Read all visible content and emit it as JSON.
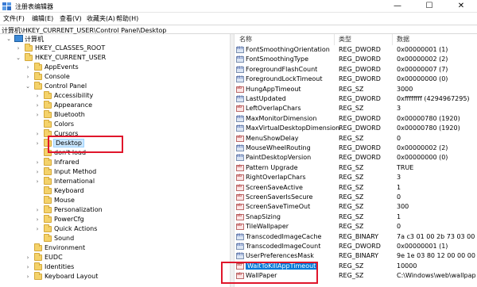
{
  "window": {
    "title": "注册表编辑器",
    "minimize": "—",
    "maximize": "☐",
    "close": "✕"
  },
  "menu": [
    "文件(F)",
    "编辑(E)",
    "查看(V)",
    "收藏夹(A)",
    "帮助(H)"
  ],
  "address": "计算机\\HKEY_CURRENT_USER\\Control Panel\\Desktop",
  "tree": [
    {
      "label": "计算机",
      "expander": "⌄",
      "kind": "pc"
    },
    {
      "label": "HKEY_CLASSES_ROOT",
      "expander": "›",
      "kind": "folder"
    },
    {
      "label": "HKEY_CURRENT_USER",
      "expander": "⌄",
      "kind": "folder"
    },
    {
      "label": "AppEvents",
      "expander": "›",
      "kind": "folder"
    },
    {
      "label": "Console",
      "expander": "›",
      "kind": "folder"
    },
    {
      "label": "Control Panel",
      "expander": "⌄",
      "kind": "folder"
    },
    {
      "label": "Accessibility",
      "expander": "›",
      "kind": "folder"
    },
    {
      "label": "Appearance",
      "expander": "›",
      "kind": "folder"
    },
    {
      "label": "Bluetooth",
      "expander": "›",
      "kind": "folder"
    },
    {
      "label": "Colors",
      "expander": "",
      "kind": "folder"
    },
    {
      "label": "Cursors",
      "expander": "›",
      "kind": "folder"
    },
    {
      "label": "Desktop",
      "expander": "›",
      "kind": "folder",
      "selected": true
    },
    {
      "label": "don't load",
      "expander": "",
      "kind": "folder"
    },
    {
      "label": "Infrared",
      "expander": "›",
      "kind": "folder"
    },
    {
      "label": "Input Method",
      "expander": "›",
      "kind": "folder"
    },
    {
      "label": "International",
      "expander": "›",
      "kind": "folder"
    },
    {
      "label": "Keyboard",
      "expander": "",
      "kind": "folder"
    },
    {
      "label": "Mouse",
      "expander": "",
      "kind": "folder"
    },
    {
      "label": "Personalization",
      "expander": "›",
      "kind": "folder"
    },
    {
      "label": "PowerCfg",
      "expander": "›",
      "kind": "folder"
    },
    {
      "label": "Quick Actions",
      "expander": "›",
      "kind": "folder"
    },
    {
      "label": "Sound",
      "expander": "",
      "kind": "folder"
    },
    {
      "label": "Environment",
      "expander": "",
      "kind": "folder"
    },
    {
      "label": "EUDC",
      "expander": "›",
      "kind": "folder"
    },
    {
      "label": "Identities",
      "expander": "›",
      "kind": "folder"
    },
    {
      "label": "Keyboard Layout",
      "expander": "›",
      "kind": "folder"
    }
  ],
  "columns": {
    "name": "名称",
    "type": "类型",
    "data": "数据"
  },
  "values": [
    {
      "name": "FontSmoothingOrientation",
      "type": "REG_DWORD",
      "data": "0x00000001 (1)",
      "icon": "dword"
    },
    {
      "name": "FontSmoothingType",
      "type": "REG_DWORD",
      "data": "0x00000002 (2)",
      "icon": "dword"
    },
    {
      "name": "ForegroundFlashCount",
      "type": "REG_DWORD",
      "data": "0x00000007 (7)",
      "icon": "dword"
    },
    {
      "name": "ForegroundLockTimeout",
      "type": "REG_DWORD",
      "data": "0x00000000 (0)",
      "icon": "dword"
    },
    {
      "name": "HungAppTimeout",
      "type": "REG_SZ",
      "data": "3000",
      "icon": "string"
    },
    {
      "name": "LastUpdated",
      "type": "REG_DWORD",
      "data": "0xffffffff (4294967295)",
      "icon": "dword"
    },
    {
      "name": "LeftOverlapChars",
      "type": "REG_SZ",
      "data": "3",
      "icon": "string"
    },
    {
      "name": "MaxMonitorDimension",
      "type": "REG_DWORD",
      "data": "0x00000780 (1920)",
      "icon": "dword"
    },
    {
      "name": "MaxVirtualDesktopDimension",
      "type": "REG_DWORD",
      "data": "0x00000780 (1920)",
      "icon": "dword"
    },
    {
      "name": "MenuShowDelay",
      "type": "REG_SZ",
      "data": "0",
      "icon": "string"
    },
    {
      "name": "MouseWheelRouting",
      "type": "REG_DWORD",
      "data": "0x00000002 (2)",
      "icon": "dword"
    },
    {
      "name": "PaintDesktopVersion",
      "type": "REG_DWORD",
      "data": "0x00000000 (0)",
      "icon": "dword"
    },
    {
      "name": "Pattern Upgrade",
      "type": "REG_SZ",
      "data": "TRUE",
      "icon": "string"
    },
    {
      "name": "RightOverlapChars",
      "type": "REG_SZ",
      "data": "3",
      "icon": "string"
    },
    {
      "name": "ScreenSaveActive",
      "type": "REG_SZ",
      "data": "1",
      "icon": "string"
    },
    {
      "name": "ScreenSaverIsSecure",
      "type": "REG_SZ",
      "data": "0",
      "icon": "string"
    },
    {
      "name": "ScreenSaveTimeOut",
      "type": "REG_SZ",
      "data": "300",
      "icon": "string"
    },
    {
      "name": "SnapSizing",
      "type": "REG_SZ",
      "data": "1",
      "icon": "string"
    },
    {
      "name": "TileWallpaper",
      "type": "REG_SZ",
      "data": "0",
      "icon": "string"
    },
    {
      "name": "TranscodedImageCache",
      "type": "REG_BINARY",
      "data": "7a c3 01 00 2b 73 03 00",
      "icon": "binary"
    },
    {
      "name": "TranscodedImageCount",
      "type": "REG_DWORD",
      "data": "0x00000001 (1)",
      "icon": "dword"
    },
    {
      "name": "UserPreferencesMask",
      "type": "REG_BINARY",
      "data": "9e 1e 03 80 12 00 00 00",
      "icon": "binary"
    },
    {
      "name": "WaitToKillAppTimeout",
      "type": "REG_SZ",
      "data": "10000",
      "icon": "string",
      "selected": true
    },
    {
      "name": "WallPaper",
      "type": "REG_SZ",
      "data": "C:\\Windows\\web\\wallpap",
      "icon": "string"
    }
  ],
  "colors": {
    "highlight_box": "#e0162b",
    "selection": "#0078d7",
    "folder": "#f4d26a"
  }
}
